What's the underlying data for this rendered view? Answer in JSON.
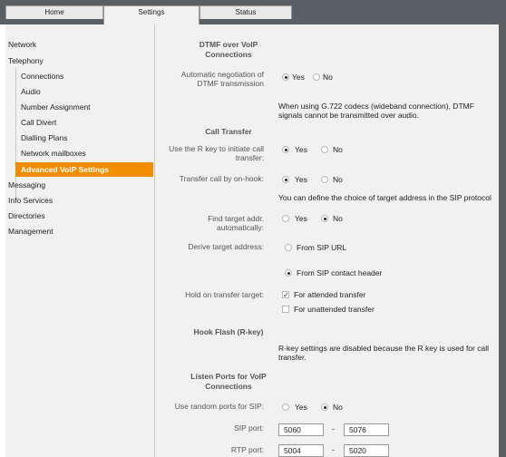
{
  "tabs": {
    "home": "Home",
    "settings": "Settings",
    "status": "Status"
  },
  "sidebar": {
    "network": "Network",
    "telephony": "Telephony",
    "sub": [
      "Connections",
      "Audio",
      "Number Assignment",
      "Call Divert",
      "Dialling Plans",
      "Network mailboxes"
    ],
    "active": "Advanced VoIP Settings",
    "rest": [
      "Messaging",
      "Info Services",
      "Directories",
      "Management"
    ]
  },
  "dtmf": {
    "header1": "DTMF over VoIP",
    "header2": "Connections",
    "label1": "Automatic negotiation of",
    "label2": "DTMF transmission",
    "yes": "Yes",
    "no": "No",
    "note1": "When using G.722 codecs (wideband connection), DTMF",
    "note2": "signals cannot be transmitted over audio."
  },
  "transfer": {
    "header": "Call Transfer",
    "rkey1": "Use the R key to initiate call",
    "rkey2": "transfer:",
    "onhook": "Transfer call by on-hook:",
    "yes": "Yes",
    "no": "No",
    "note": "You can define the choice of target address in the SIP protocol",
    "find1": "Find target addr.",
    "find2": "automatically:",
    "derive": "Derive target address:",
    "from_url": "From SIP URL",
    "from_contact": "From SIP contact header",
    "hold": "Hold on transfer target:",
    "attended": "For attended transfer",
    "unattended": "For unattended transfer"
  },
  "hookflash": {
    "header": "Hook Flash (R-key)",
    "note1": "R-key settings are disabled because the R key is used for call",
    "note2": "transfer."
  },
  "ports": {
    "header1": "Listen Ports for VoIP",
    "header2": "Connections",
    "random": "Use random ports for SIP:",
    "yes": "Yes",
    "no": "No",
    "sip_label": "SIP port:",
    "sip_from": "5060",
    "sip_to": "5076",
    "rtp_label": "RTP port:",
    "rtp_from": "5004",
    "rtp_to": "5020",
    "sep": "-"
  }
}
